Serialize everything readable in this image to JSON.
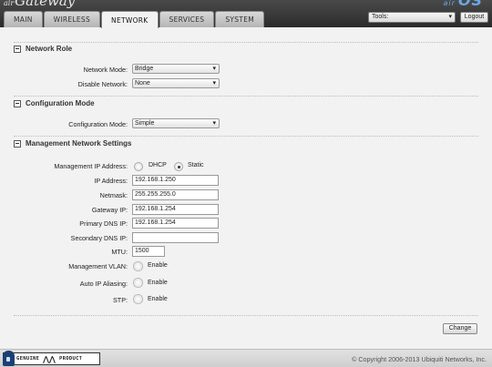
{
  "header": {
    "brand_prefix": "air",
    "brand_name": "Gateway",
    "brand_right_prefix": "air",
    "brand_right_name": "OS",
    "tabs": [
      {
        "label": "MAIN"
      },
      {
        "label": "WIRELESS"
      },
      {
        "label": "NETWORK",
        "active": true
      },
      {
        "label": "SERVICES"
      },
      {
        "label": "SYSTEM"
      }
    ],
    "tools_select": {
      "value": "Tools:",
      "icon": "chevron-down-icon"
    },
    "logout_label": "Logout"
  },
  "network_role": {
    "title": "Network Role",
    "network_mode": {
      "label": "Network Mode:",
      "value": "Bridge"
    },
    "disable_network": {
      "label": "Disable Network:",
      "value": "None"
    }
  },
  "configuration_mode": {
    "title": "Configuration Mode",
    "mode": {
      "label": "Configuration Mode:",
      "value": "Simple"
    }
  },
  "management": {
    "title": "Management Network Settings",
    "ip_address_mode": {
      "label": "Management IP Address:",
      "options": [
        "DHCP",
        "Static"
      ],
      "selected": "Static"
    },
    "ip_address": {
      "label": "IP Address:",
      "value": "192.168.1.250"
    },
    "netmask": {
      "label": "Netmask:",
      "value": "255.255.255.0"
    },
    "gateway_ip": {
      "label": "Gateway IP:",
      "value": "192.168.1.254"
    },
    "primary_dns": {
      "label": "Primary DNS IP:",
      "value": "192.168.1.254"
    },
    "secondary_dns": {
      "label": "Secondary DNS IP:",
      "value": ""
    },
    "mtu": {
      "label": "MTU:",
      "value": "1500"
    },
    "management_vlan": {
      "label": "Management VLAN:",
      "checkbox_label": "Enable",
      "checked": false
    },
    "auto_ip_aliasing": {
      "label": "Auto IP Aliasing:",
      "checkbox_label": "Enable",
      "checked": false
    },
    "stp": {
      "label": "STP:",
      "checkbox_label": "Enable",
      "checked": false
    }
  },
  "change_label": "Change",
  "footer": {
    "badge_left": "GENUINE",
    "badge_right": "PRODUCT",
    "copyright": "© Copyright 2006-2013 Ubiquiti Networks, Inc."
  },
  "colors": {
    "header_bg": "#333333",
    "brand_right": "#6aa8e8",
    "page_bg": "#f2f2f2"
  }
}
